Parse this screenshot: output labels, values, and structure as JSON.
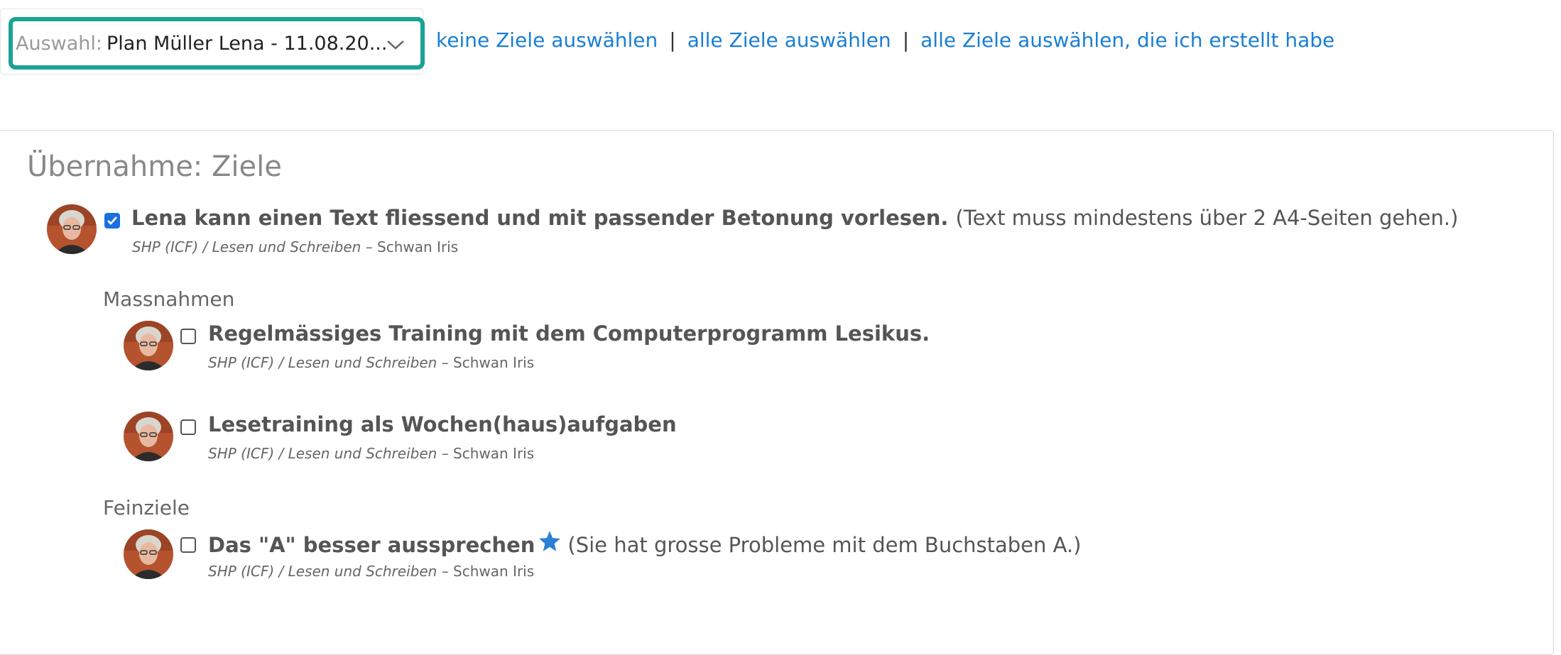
{
  "selector": {
    "prefix": "Auswahl:",
    "value": "Plan Müller Lena - 11.08.20..."
  },
  "links": {
    "none": "keine Ziele auswählen",
    "all": "alle Ziele auswählen",
    "mine": "alle Ziele auswählen, die ich erstellt habe",
    "separator": "|"
  },
  "panel": {
    "title": "Übernahme: Ziele"
  },
  "goal": {
    "title": "Lena kann einen Text fliessend und mit passender Betonung vorlesen.",
    "note": "(Text muss mindestens über 2 A4-Seiten gehen.)",
    "category": "SHP (ICF) / Lesen und Schreiben",
    "author": "– Schwan Iris",
    "checked": true
  },
  "sections": {
    "massnahmen": "Massnahmen",
    "feinziele": "Feinziele"
  },
  "massnahmen": [
    {
      "title": "Regelmässiges Training mit dem Computerprogramm Lesikus.",
      "category": "SHP (ICF) / Lesen und Schreiben",
      "author": "– Schwan Iris",
      "checked": false
    },
    {
      "title": "Lesetraining als Wochen(haus)aufgaben",
      "category": "SHP (ICF) / Lesen und Schreiben",
      "author": "– Schwan Iris",
      "checked": false
    }
  ],
  "feinziele": [
    {
      "title": "Das \"A\" besser aussprechen",
      "note": "(Sie hat grosse Probleme mit dem Buchstaben A.)",
      "category": "SHP (ICF) / Lesen und Schreiben",
      "author": "– Schwan Iris",
      "checked": false,
      "starred": true
    }
  ],
  "colors": {
    "accent_border": "#1ba396",
    "link": "#1a7fd4",
    "checkbox_checked": "#1b6fe0",
    "star": "#2a7fd4"
  }
}
